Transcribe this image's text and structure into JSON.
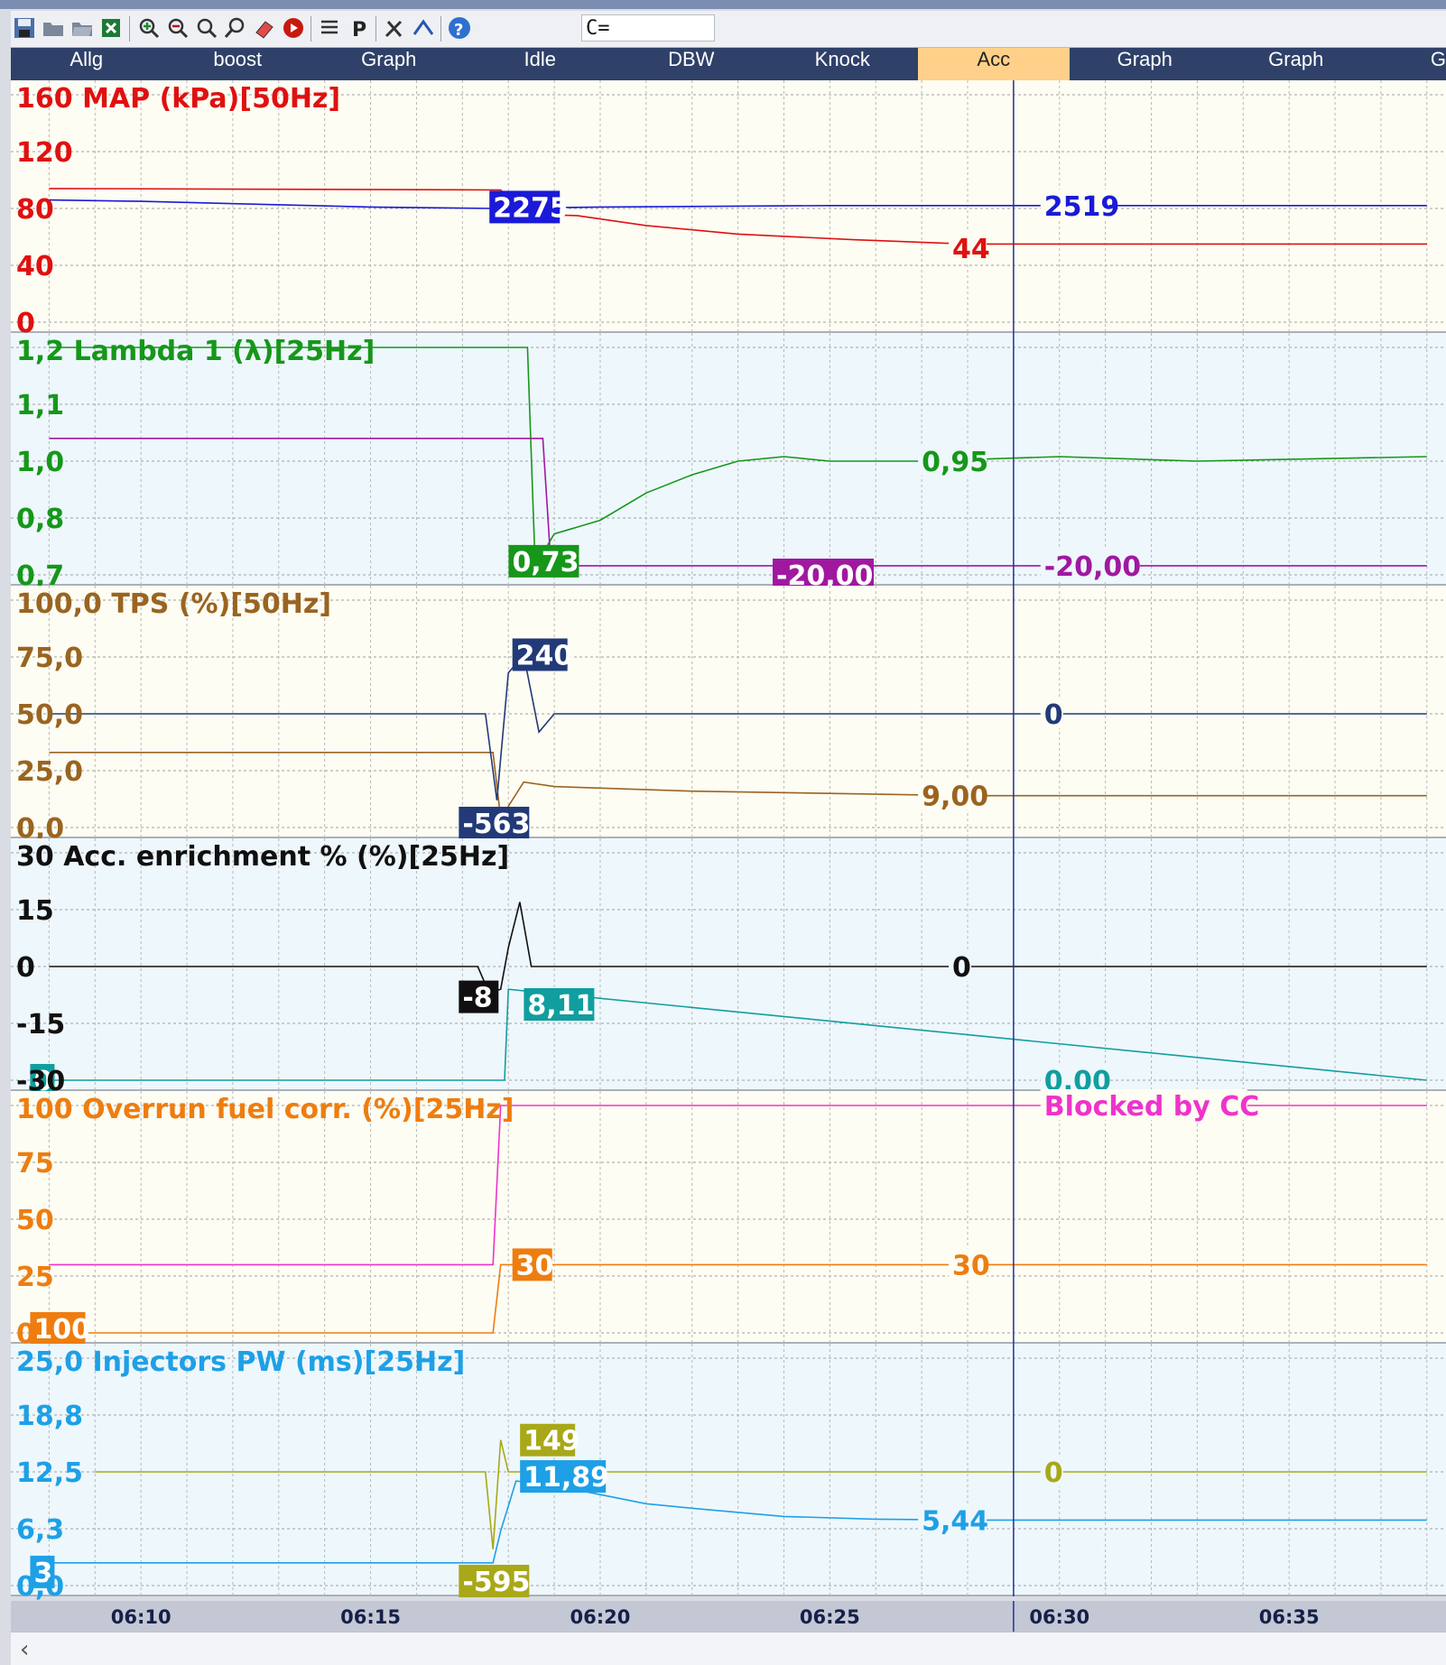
{
  "toolbar": {
    "icons": [
      "save-icon",
      "open-icon",
      "open-folder-icon",
      "excel-export-icon",
      "zoom-in-icon",
      "zoom-out-icon",
      "zoom-fit-icon",
      "search-icon",
      "eraser-icon",
      "record-icon",
      "list-icon",
      "parameter-icon",
      "tools-icon",
      "route-icon",
      "help-icon"
    ],
    "formula": "C="
  },
  "tabs": [
    {
      "label": "Allg"
    },
    {
      "label": "boost"
    },
    {
      "label": "Graph"
    },
    {
      "label": "Idle"
    },
    {
      "label": "DBW"
    },
    {
      "label": "Knock"
    },
    {
      "label": "Acc",
      "active": true
    },
    {
      "label": "Graph"
    },
    {
      "label": "Graph"
    },
    {
      "label": "Gra"
    }
  ],
  "colors": {
    "map": "#e01010",
    "rpm": "#1a1ad8",
    "lambda": "#16971a",
    "lambda_target": "#a018a0",
    "tps": "#9a6420",
    "tps_rate": "#223a78",
    "acc": "#101010",
    "acc2": "#119e9e",
    "overrun": "#ee7d10",
    "overrun2": "#ee33cc",
    "inj": "#1ea0e6",
    "inj2": "#a8a818",
    "cursor": "#2030a0"
  },
  "chart_data": {
    "type": "line",
    "x_ticks": [
      "06:10",
      "06:15",
      "06:20",
      "06:25",
      "06:30",
      "06:35"
    ],
    "x_range": [
      "06:07:10",
      "06:38:25"
    ],
    "cursor_x": "06:29:00",
    "grid": true,
    "panels": [
      {
        "title": "160 MAP (kPa)[50Hz]",
        "ticks": [
          "120",
          "80",
          "40",
          "0"
        ],
        "ylim": [
          0,
          160
        ],
        "series": [
          {
            "id": "map",
            "points": [
              [
                "06:08",
                94
              ],
              [
                "06:17:50",
                93
              ],
              [
                "06:18:20",
                76
              ],
              [
                "06:19:30",
                75
              ],
              [
                "06:21",
                68
              ],
              [
                "06:23",
                62
              ],
              [
                "06:25:30",
                58
              ],
              [
                "06:28",
                55
              ],
              [
                "06:38",
                55
              ]
            ],
            "labels": [
              {
                "t": "44",
                "x": "06:27:40",
                "y": 52
              }
            ]
          },
          {
            "id": "rpm",
            "points": [
              [
                "06:08",
                86
              ],
              [
                "06:10",
                85
              ],
              [
                "06:15",
                81
              ],
              [
                "06:17:40",
                80
              ],
              [
                "06:20",
                81
              ],
              [
                "06:25",
                82
              ],
              [
                "06:28",
                82
              ],
              [
                "06:38",
                82
              ]
            ],
            "labels": [
              {
                "t": "2275",
                "x": "06:17:40",
                "y": 81,
                "boxed": true
              },
              {
                "t": "2519",
                "x": "06:29:40",
                "y": 82
              }
            ]
          }
        ]
      },
      {
        "title": "1,2 Lambda 1 (λ)[25Hz]",
        "ticks": [
          "1,1",
          "1,0",
          "0,8",
          "0,7"
        ],
        "ylim": [
          0.7,
          1.2
        ],
        "series": [
          {
            "id": "lambda",
            "points": [
              [
                "06:08",
                1.2
              ],
              [
                "06:18:25",
                1.2
              ],
              [
                "06:18:35",
                0.72
              ],
              [
                "06:19",
                0.79
              ],
              [
                "06:20",
                0.82
              ],
              [
                "06:21",
                0.88
              ],
              [
                "06:22",
                0.92
              ],
              [
                "06:23",
                0.95
              ],
              [
                "06:24",
                0.96
              ],
              [
                "06:25",
                0.95
              ],
              [
                "06:27",
                0.95
              ],
              [
                "06:30",
                0.96
              ],
              [
                "06:33",
                0.95
              ],
              [
                "06:38",
                0.96
              ]
            ],
            "labels": [
              {
                "t": "0,73",
                "x": "06:18:05",
                "y": 0.73,
                "boxed": true
              },
              {
                "t": "0,95",
                "x": "06:27:00",
                "y": 0.95
              }
            ]
          },
          {
            "id": "lambda_target",
            "points": [
              [
                "06:08",
                1.0
              ],
              [
                "06:18:45",
                1.0
              ],
              [
                "06:18:55",
                0.74
              ],
              [
                "06:19:20",
                0.72
              ],
              [
                "06:38",
                0.72
              ]
            ],
            "labels": [
              {
                "t": "-20,00",
                "x": "06:23:50",
                "y": 0.7,
                "boxed": true
              },
              {
                "t": "-20,00",
                "x": "06:29:40",
                "y": 0.72
              }
            ]
          }
        ]
      },
      {
        "title": "100,0 TPS (%)[50Hz]",
        "ticks": [
          "75,0",
          "50,0",
          "25,0",
          "0,0"
        ],
        "ylim": [
          0,
          100
        ],
        "series": [
          {
            "id": "tps",
            "points": [
              [
                "06:08",
                33
              ],
              [
                "06:17:40",
                33
              ],
              [
                "06:17:50",
                4
              ],
              [
                "06:18:20",
                20
              ],
              [
                "06:19",
                18
              ],
              [
                "06:22",
                16
              ],
              [
                "06:25",
                15
              ],
              [
                "06:28",
                14
              ],
              [
                "06:38",
                14
              ]
            ],
            "labels": [
              {
                "t": "9,00",
                "x": "06:27:00",
                "y": 14
              }
            ]
          },
          {
            "id": "tps_rate",
            "points": [
              [
                "06:08",
                50
              ],
              [
                "06:17:30",
                50
              ],
              [
                "06:17:45",
                12
              ],
              [
                "06:18",
                68
              ],
              [
                "06:18:20",
                76
              ],
              [
                "06:18:40",
                42
              ],
              [
                "06:19",
                50
              ],
              [
                "06:38",
                50
              ]
            ],
            "labels": [
              {
                "t": "240",
                "x": "06:18:10",
                "y": 76,
                "boxed": true
              },
              {
                "t": "-563",
                "x": "06:17:00",
                "y": 2,
                "boxed": true
              },
              {
                "t": "0",
                "x": "06:29:40",
                "y": 50
              }
            ]
          }
        ]
      },
      {
        "title": "30 Acc. enrichment % (%)[25Hz]",
        "ticks": [
          "15",
          "0",
          "-15",
          "-30"
        ],
        "ylim": [
          -30,
          30
        ],
        "series": [
          {
            "id": "acc",
            "points": [
              [
                "06:08",
                0
              ],
              [
                "06:17:20",
                0
              ],
              [
                "06:17:35",
                -7
              ],
              [
                "06:17:50",
                -6
              ],
              [
                "06:18",
                5
              ],
              [
                "06:18:15",
                17
              ],
              [
                "06:18:30",
                0
              ],
              [
                "06:38",
                0
              ]
            ],
            "labels": [
              {
                "t": "-8",
                "x": "06:17:00",
                "y": -8,
                "boxed": true
              },
              {
                "t": "0",
                "x": "06:27:40",
                "y": 0
              }
            ]
          },
          {
            "id": "acc2",
            "points": [
              [
                "06:08",
                -30
              ],
              [
                "06:17:55",
                -30
              ],
              [
                "06:18:00",
                -6
              ],
              [
                "06:38",
                -30
              ]
            ],
            "labels": [
              {
                "t": "8,11",
                "x": "06:18:25",
                "y": -10,
                "boxed": true
              },
              {
                "t": "0",
                "x": "06:07:40",
                "y": -30,
                "boxed": true
              },
              {
                "t": "0,00",
                "x": "06:29:40",
                "y": -30
              }
            ]
          }
        ]
      },
      {
        "title": "100 Overrun fuel corr. (%)[25Hz]",
        "ticks": [
          "75",
          "50",
          "25",
          "0"
        ],
        "ylim": [
          0,
          100
        ],
        "series": [
          {
            "id": "overrun",
            "points": [
              [
                "06:08",
                0
              ],
              [
                "06:17:40",
                0
              ],
              [
                "06:17:50",
                30
              ],
              [
                "06:38",
                30
              ]
            ],
            "labels": [
              {
                "t": "30",
                "x": "06:18:10",
                "y": 30,
                "boxed": true
              },
              {
                "t": "30",
                "x": "06:27:40",
                "y": 30
              },
              {
                "t": "100",
                "x": "06:07:40",
                "y": 2,
                "boxed": true
              }
            ]
          },
          {
            "id": "overrun2",
            "points": [
              [
                "06:08",
                30
              ],
              [
                "06:17:40",
                30
              ],
              [
                "06:17:50",
                100
              ],
              [
                "06:38",
                100
              ]
            ],
            "labels": [
              {
                "t": "Blocked by CC",
                "x": "06:29:40",
                "y": 100
              }
            ]
          }
        ]
      },
      {
        "title": "25,0 Injectors PW (ms)[25Hz]",
        "ticks": [
          "18,8",
          "12,5",
          "6,3",
          "0,0"
        ],
        "ylim": [
          0,
          25
        ],
        "series": [
          {
            "id": "inj",
            "points": [
              [
                "06:08",
                2.5
              ],
              [
                "06:17:40",
                2.5
              ],
              [
                "06:17:50",
                6
              ],
              [
                "06:18:10",
                11.5
              ],
              [
                "06:19",
                11
              ],
              [
                "06:20",
                10
              ],
              [
                "06:21",
                9
              ],
              [
                "06:22",
                8.5
              ],
              [
                "06:24",
                7.6
              ],
              [
                "06:26",
                7.3
              ],
              [
                "06:28",
                7.2
              ],
              [
                "06:38",
                7.2
              ]
            ],
            "labels": [
              {
                "t": "11,89",
                "x": "06:18:20",
                "y": 12,
                "boxed": true
              },
              {
                "t": "5,44",
                "x": "06:27:00",
                "y": 7.2
              },
              {
                "t": "3",
                "x": "06:07:40",
                "y": 1.5,
                "boxed": true
              }
            ]
          },
          {
            "id": "inj2",
            "points": [
              [
                "06:09",
                12.5
              ],
              [
                "06:17:30",
                12.5
              ],
              [
                "06:17:40",
                4
              ],
              [
                "06:17:50",
                16
              ],
              [
                "06:18",
                12.5
              ],
              [
                "06:38",
                12.5
              ]
            ],
            "labels": [
              {
                "t": "149",
                "x": "06:18:20",
                "y": 16,
                "boxed": true
              },
              {
                "t": "-595",
                "x": "06:17:00",
                "y": 0.5,
                "boxed": true
              },
              {
                "t": "0",
                "x": "06:29:40",
                "y": 12.5
              }
            ]
          }
        ]
      }
    ]
  }
}
